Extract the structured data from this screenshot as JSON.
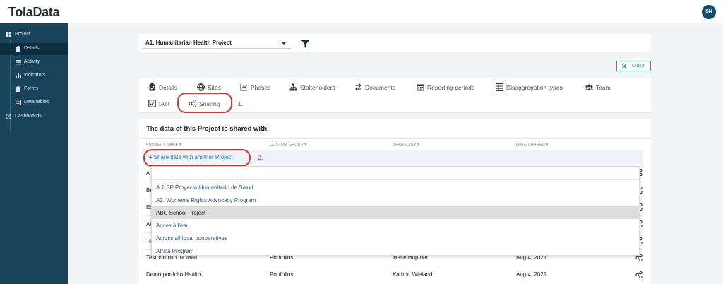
{
  "app": {
    "logo": "ToIaData",
    "avatar_initials": "SN"
  },
  "sidebar": {
    "items": [
      {
        "label": "Project",
        "icon": "grid-icon"
      },
      {
        "label": "Details",
        "icon": "clipboard-icon"
      },
      {
        "label": "Activity",
        "icon": "list-icon"
      },
      {
        "label": "Indicators",
        "icon": "bar-chart-icon"
      },
      {
        "label": "Forms",
        "icon": "clipboard-icon"
      },
      {
        "label": "Data tables",
        "icon": "table-icon"
      },
      {
        "label": "Dashboards",
        "icon": "gauge-icon"
      }
    ]
  },
  "project_select": {
    "value": "A1. Humanitarian Health Project"
  },
  "close_button": {
    "label": "Close"
  },
  "tabs": [
    {
      "label": "Details",
      "icon": "clipboard-icon"
    },
    {
      "label": "Sites",
      "icon": "globe-icon"
    },
    {
      "label": "Phases",
      "icon": "chart-icon"
    },
    {
      "label": "Stakeholders",
      "icon": "hierarchy-icon"
    },
    {
      "label": "Documents",
      "icon": "swap-icon"
    },
    {
      "label": "Reporting periods",
      "icon": "calendar-icon"
    },
    {
      "label": "Disaggregation types",
      "icon": "table-icon"
    },
    {
      "label": "Team",
      "icon": "users-icon"
    },
    {
      "label": "IATI",
      "icon": "checkbox-icon"
    },
    {
      "label": "Sharing",
      "icon": "share-icon"
    }
  ],
  "annotations": {
    "one": "1.",
    "two": "2."
  },
  "content": {
    "heading": "The data of this Project is shared with:",
    "columns": [
      "PROJECT NAME",
      "CUSTOM GROUP",
      "SHARED BY",
      "DATE SHARED"
    ],
    "share_link": "Share data with another Project",
    "rows": [
      {
        "name": "A",
        "group": "",
        "by": "",
        "date": ""
      },
      {
        "name": "Be",
        "group": "",
        "by": "",
        "date": ""
      },
      {
        "name": "Ex",
        "group": "",
        "by": "",
        "date": ""
      },
      {
        "name": "Al",
        "group": "",
        "by": "",
        "date": ""
      },
      {
        "name": "Te",
        "group": "",
        "by": "",
        "date": ""
      },
      {
        "name": "Testportfolio für Matt",
        "group": "Portfolios",
        "by": "Malte Höpfner",
        "date": "Aug 4, 2021"
      },
      {
        "name": "Demo portfolio Health",
        "group": "Portfolios",
        "by": "Kathrin Wieland",
        "date": "Aug 4, 2021"
      }
    ]
  },
  "dropdown": {
    "options": [
      "A.1 SP Proyecto Humanitario de Salud",
      "A2. Women's Rights Advocacy Program",
      "ABC School Project",
      "Accès à l'eau",
      "Across all local cooperatives",
      "Africa Program"
    ],
    "highlighted": "ABC School Project"
  },
  "colors": {
    "sidebar": "#18435a",
    "accent": "#2e9e7a",
    "annotation": "#d9372d",
    "link": "#2a7ab9"
  }
}
